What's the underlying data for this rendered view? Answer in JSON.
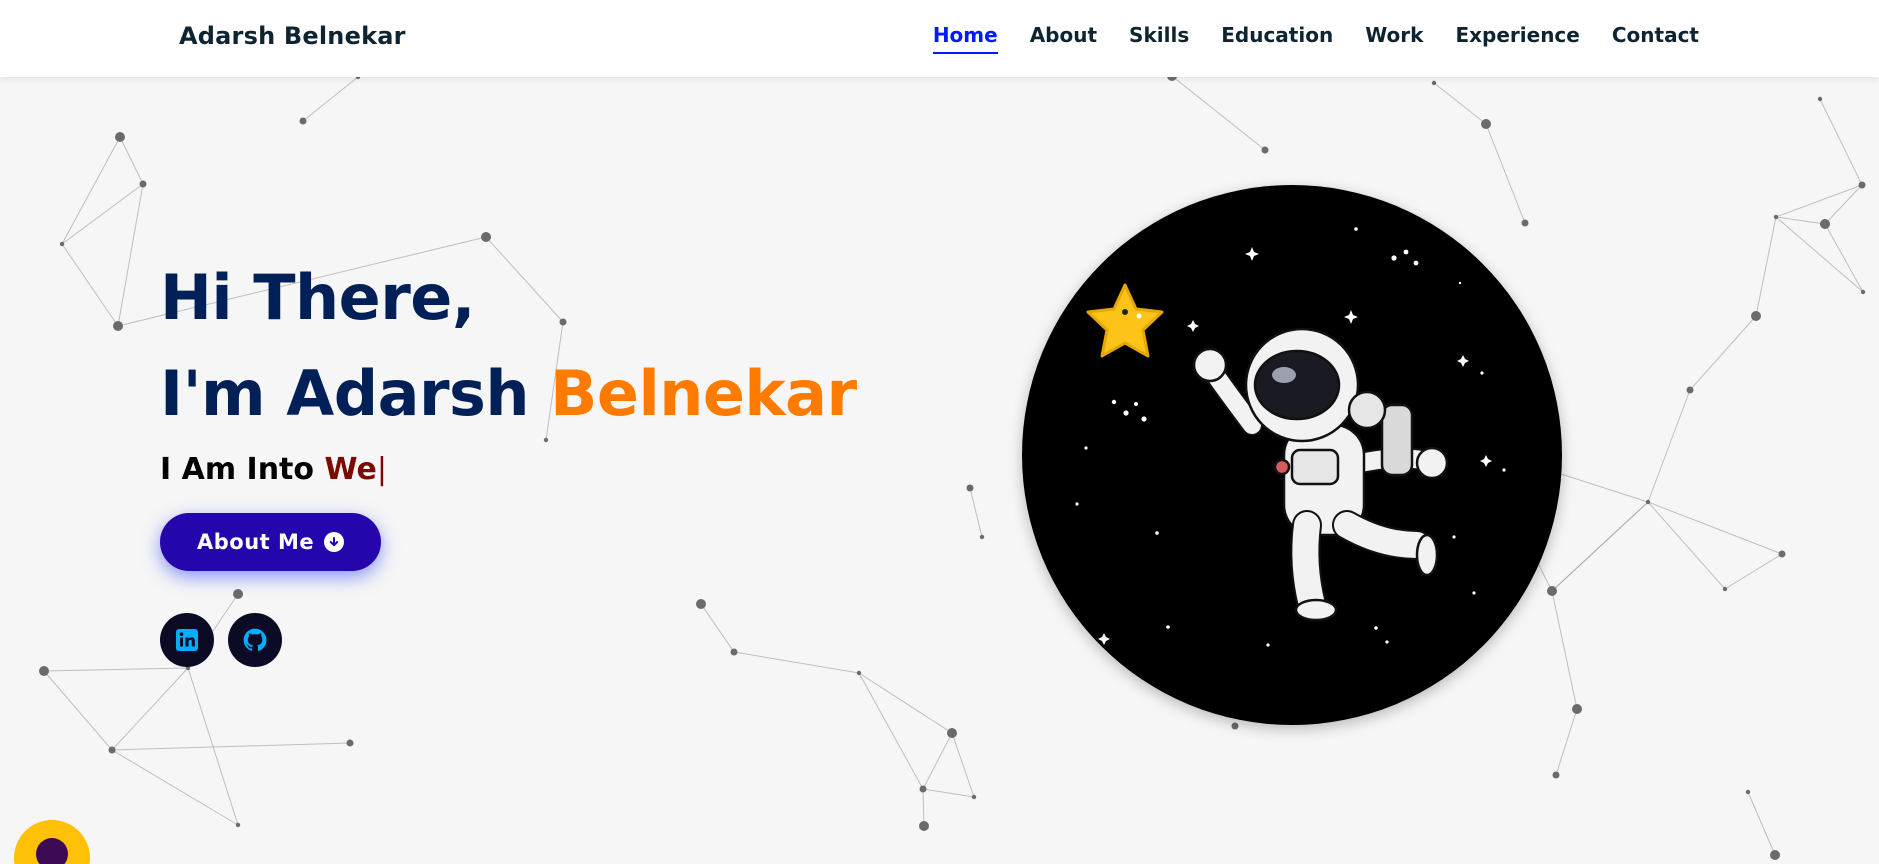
{
  "brand": "Adarsh Belnekar",
  "nav": [
    {
      "label": "Home",
      "active": true
    },
    {
      "label": "About"
    },
    {
      "label": "Skills"
    },
    {
      "label": "Education"
    },
    {
      "label": "Work"
    },
    {
      "label": "Experience"
    },
    {
      "label": "Contact"
    }
  ],
  "hero": {
    "line1": "Hi There,",
    "line2_prefix": "I'm Adarsh ",
    "line2_accent": "Belnekar",
    "typing_prefix": "I Am Into ",
    "typing_current": "We",
    "typing_cursor": "|",
    "button_label": "About Me"
  },
  "social_icons": [
    "linkedin-icon",
    "github-icon"
  ],
  "illustration": "astronaut-with-star-icon",
  "colors": {
    "nav_active": "#011aff",
    "heading": "#002057",
    "accent_orange": "#ff7b00",
    "typed_text": "#7c0a02",
    "button_bg": "#2506ad",
    "social_bg": "#0b0b25",
    "social_icon": "#00aeff",
    "scroll_top_bg": "#ffc107"
  }
}
